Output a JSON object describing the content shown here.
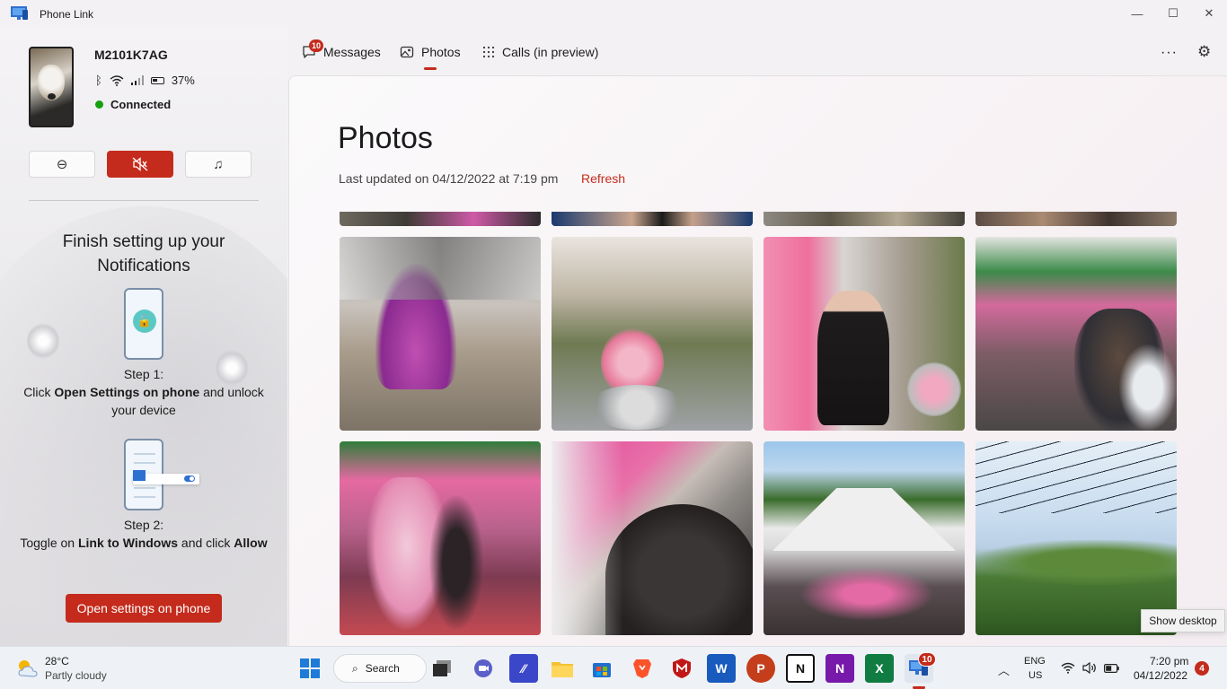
{
  "window": {
    "title": "Phone Link",
    "controls": {
      "minimize": "—",
      "maximize": "☐",
      "close": "✕"
    }
  },
  "device": {
    "name": "M2101K7AG",
    "battery": "37%",
    "status": "Connected",
    "status_color": "#13a10e"
  },
  "quick_actions": {
    "dnd_icon": "⊖",
    "mute_icon": "🔇",
    "music_icon": "♫"
  },
  "setup": {
    "title": "Finish setting up your Notifications",
    "step1_label": "Step 1:",
    "step1_pre": "Click ",
    "step1_bold": "Open Settings on phone",
    "step1_post": " and unlock your device",
    "step2_label": "Step 2:",
    "step2_pre": "Toggle on ",
    "step2_bold": "Link to Windows",
    "step2_mid": " and click ",
    "step2_bold2": "Allow",
    "button": "Open settings on phone"
  },
  "tabs": [
    {
      "label": "Messages",
      "icon": "message-icon",
      "badge": "10"
    },
    {
      "label": "Photos",
      "icon": "photo-icon",
      "active": true
    },
    {
      "label": "Calls (in preview)",
      "icon": "dialpad-icon"
    }
  ],
  "toolbar": {
    "more": "···",
    "settings": "⚙"
  },
  "photos": {
    "title": "Photos",
    "last_updated": "Last updated on 04/12/2022 at 7:19 pm",
    "refresh": "Refresh"
  },
  "tooltip": "Show desktop",
  "taskbar": {
    "weather_temp": "28°C",
    "weather_desc": "Partly cloudy",
    "search": "Search",
    "phone_link_badge": "10",
    "lang_primary": "ENG",
    "lang_secondary": "US",
    "time": "7:20 pm",
    "date": "04/12/2022",
    "notifications": "4",
    "apps": [
      {
        "name": "start",
        "letter": ""
      },
      {
        "name": "task-view",
        "letter": ""
      },
      {
        "name": "meet",
        "letter": ""
      },
      {
        "name": "editor",
        "letter": ""
      },
      {
        "name": "file-explorer",
        "letter": ""
      },
      {
        "name": "store",
        "letter": ""
      },
      {
        "name": "brave",
        "letter": ""
      },
      {
        "name": "mcafee",
        "letter": ""
      },
      {
        "name": "word",
        "letter": "W"
      },
      {
        "name": "powerpoint",
        "letter": "P"
      },
      {
        "name": "notion",
        "letter": "N"
      },
      {
        "name": "onenote",
        "letter": "N"
      },
      {
        "name": "excel",
        "letter": "X"
      },
      {
        "name": "phone-link",
        "letter": ""
      }
    ]
  },
  "colors": {
    "accent": "#c42b1c",
    "connected": "#13a10e"
  }
}
